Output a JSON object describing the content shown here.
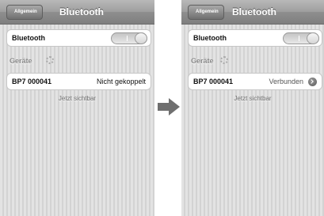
{
  "left_screen": {
    "back_label": "Allgemein",
    "title": "Bluetooth",
    "bluetooth_label": "Bluetooth",
    "bluetooth_toggle": "on",
    "section_header": "Geräte",
    "device": {
      "name": "BP7 000041",
      "status": "Nicht gekoppelt"
    },
    "footer": "Jetzt sichtbar"
  },
  "right_screen": {
    "back_label": "Allgemein",
    "title": "Bluetooth",
    "bluetooth_label": "Bluetooth",
    "bluetooth_toggle": "on",
    "section_header": "Geräte",
    "device": {
      "name": "BP7 000041",
      "status": "Verbunden",
      "detail_icon": "chevron-right-circle-icon"
    },
    "footer": "Jetzt sichtbar"
  },
  "transition_icon": "arrow-right-icon"
}
